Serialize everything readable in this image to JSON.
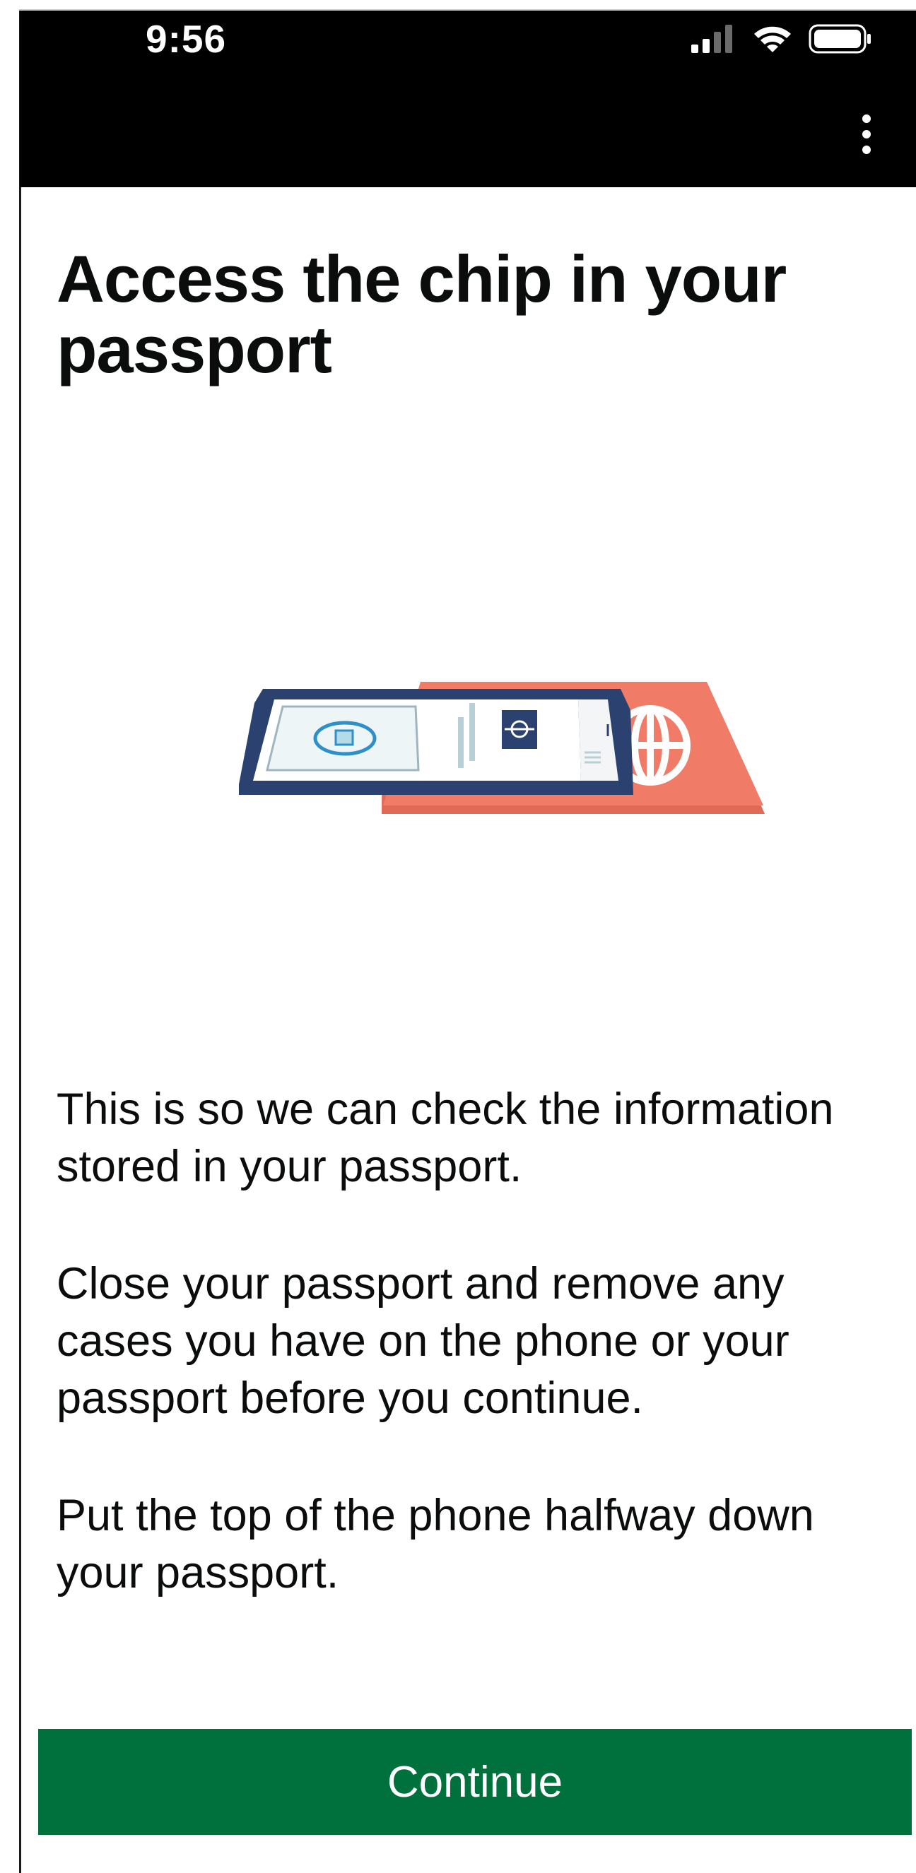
{
  "status_bar": {
    "time": "9:56",
    "icons": [
      "signal-icon",
      "wifi-icon",
      "battery-icon"
    ]
  },
  "app_bar": {
    "menu_icon": "more-vertical-icon"
  },
  "main": {
    "title": "Access the chip in your passport",
    "illustration": "phone-on-passport-illustration",
    "paragraphs": [
      "This is so we can check the information stored in your passport.",
      "Close your passport and remove any cases you have on the phone or your passport before you continue.",
      "Put the top of the phone halfway down your passport."
    ]
  },
  "footer": {
    "continue_label": "Continue"
  },
  "colors": {
    "primary_button": "#00703c",
    "passport": "#f07c67",
    "phone_frame": "#2b4270",
    "status_bar": "#000000",
    "text": "#0b0c0c"
  }
}
